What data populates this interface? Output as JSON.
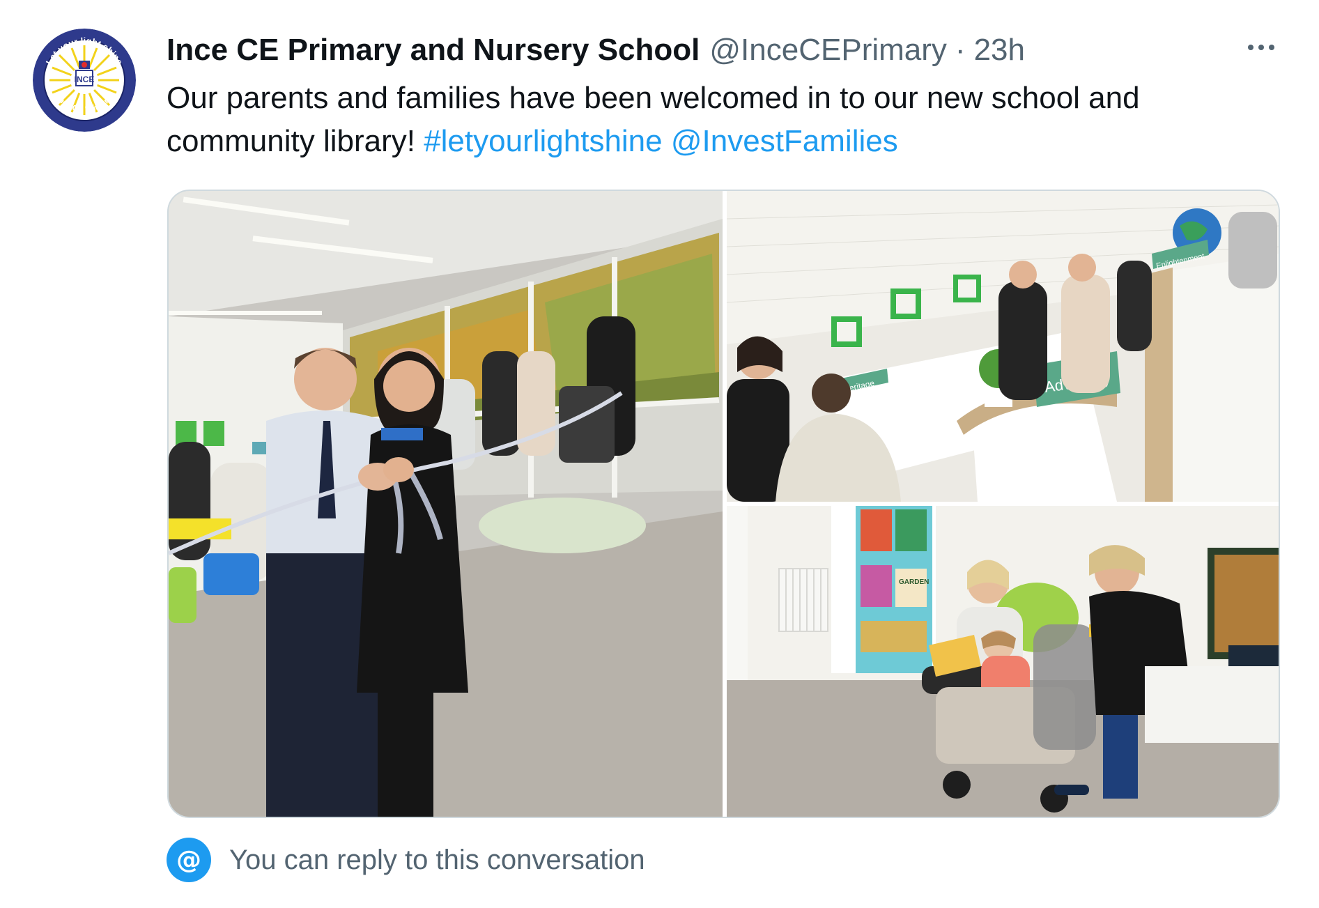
{
  "tweet": {
    "display_name": "Ince CE Primary and Nursery School",
    "handle": "@InceCEPrimary",
    "separator": "·",
    "time": "23h",
    "text": "Our parents and families have been welcomed in to our new school and community library! ",
    "hashtag": "#letyourlightshine",
    "mention": "@InvestFamilies",
    "more_icon": "ellipsis-icon"
  },
  "avatar": {
    "ring_top": "Let your light shine",
    "ring_bottom": "Ince CE Primary",
    "center": "INCE",
    "colors": {
      "ring": "#2e3a8c",
      "inner": "#ffffff",
      "rays": "#f2d21b"
    }
  },
  "media": {
    "photos": [
      {
        "name": "ribbon-cutting-photo",
        "signs": []
      },
      {
        "name": "library-shelves-photo",
        "signs": [
          "Heritage",
          "Advocacy",
          "Enlightenment"
        ]
      },
      {
        "name": "reading-corner-photo",
        "signs": [
          "GARDEN"
        ]
      }
    ]
  },
  "reply": {
    "icon": "at-icon",
    "symbol": "@",
    "text": "You can reply to this conversation"
  },
  "colors": {
    "link": "#1d9bf0",
    "secondary": "#536471",
    "border": "#cfd9de"
  }
}
